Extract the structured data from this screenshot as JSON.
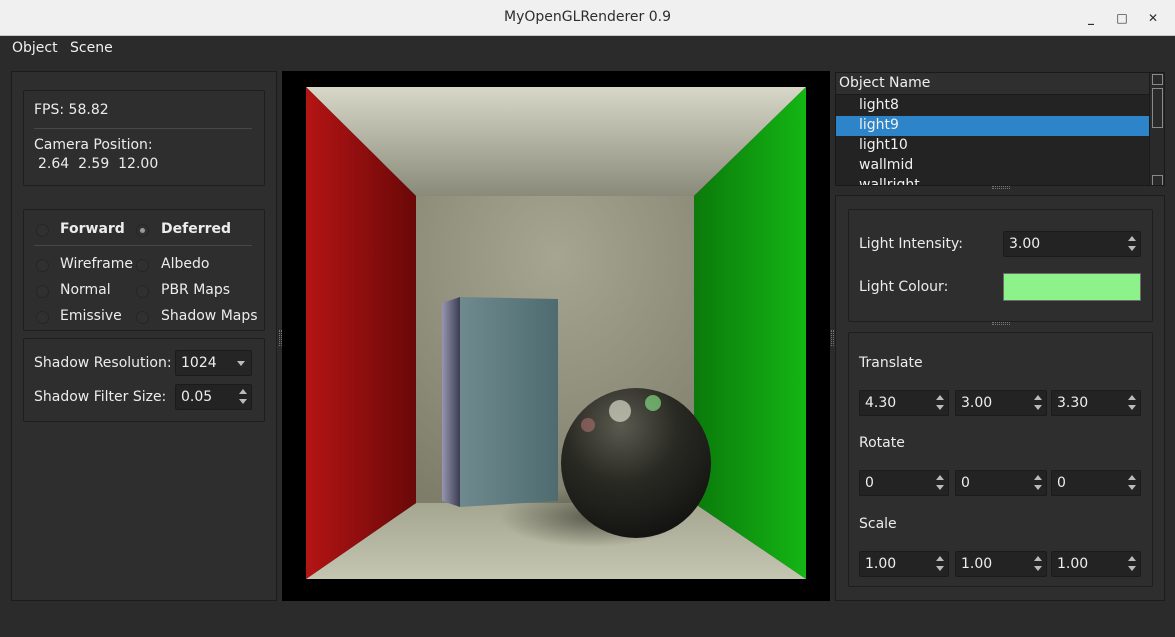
{
  "window": {
    "title": "MyOpenGLRenderer 0.9",
    "minimize_glyph": "_",
    "maximize_glyph": "□",
    "close_glyph": "✕"
  },
  "menu": {
    "object": "Object",
    "scene": "Scene"
  },
  "stats": {
    "fps": "FPS: 58.82",
    "camera_label": "Camera Position:",
    "camera_values": "2.64  2.59  12.00"
  },
  "render_modes": {
    "forward": "Forward",
    "deferred": "Deferred",
    "selected": "Deferred",
    "views": [
      "Wireframe",
      "Albedo",
      "Normal",
      "PBR Maps",
      "Emissive",
      "Shadow Maps"
    ]
  },
  "shadow": {
    "resolution_label": "Shadow Resolution:",
    "resolution_value": "1024",
    "filter_label": "Shadow Filter Size:",
    "filter_value": "0.05"
  },
  "object_list": {
    "header": "Object Name",
    "items": [
      "light8",
      "light9",
      "light10",
      "wallmid",
      "wallright"
    ],
    "selected": "light9"
  },
  "light": {
    "intensity_label": "Light Intensity:",
    "intensity_value": "3.00",
    "colour_label": "Light Colour:",
    "colour_hex": "#8ef28a"
  },
  "transform": {
    "translate_label": "Translate",
    "translate": [
      "4.30",
      "3.00",
      "3.30"
    ],
    "rotate_label": "Rotate",
    "rotate": [
      "0",
      "0",
      "0"
    ],
    "scale_label": "Scale",
    "scale": [
      "1.00",
      "1.00",
      "1.00"
    ]
  },
  "colors": {
    "selection": "#2e84c8",
    "left_wall": "#b01010",
    "right_wall": "#12b012"
  },
  "icons": [
    "radio-icon",
    "dropdown-arrow-icon",
    "spin-up-icon",
    "spin-down-icon",
    "scroll-up-icon",
    "scroll-down-icon",
    "splitter-handle-icon"
  ]
}
